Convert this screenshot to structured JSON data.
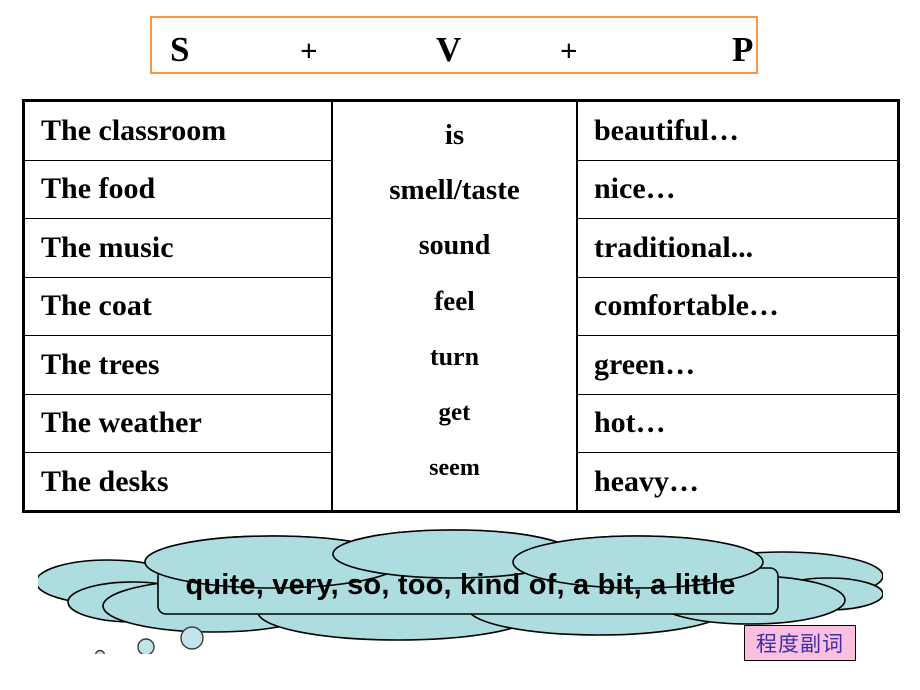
{
  "colors": {
    "formula_border": "#F79646",
    "table_border": "#000000",
    "cloud_fill": "#AEDDE0",
    "cloud_stroke": "#000000",
    "label_bg": "#FBBFE0",
    "label_text": "#3A2FA8"
  },
  "formula": {
    "subject_symbol": "S",
    "plus_one": "+",
    "verb_symbol": "V",
    "plus_two": "+",
    "predicate_symbol": "P"
  },
  "table": {
    "subjects": [
      "The classroom",
      "The food",
      "The music",
      "The coat",
      "The trees",
      "The weather",
      "The desks"
    ],
    "verbs": [
      "is",
      "smell/taste",
      "sound",
      "feel",
      "turn",
      "get",
      "seem"
    ],
    "predicates": [
      "beautiful…",
      "nice…",
      "traditional...",
      "comfortable…",
      "green…",
      "hot…",
      "heavy…"
    ]
  },
  "cloud": {
    "text": "quite, very, so, too, kind of, a bit, a little"
  },
  "degree_label": {
    "text": "程度副词"
  }
}
